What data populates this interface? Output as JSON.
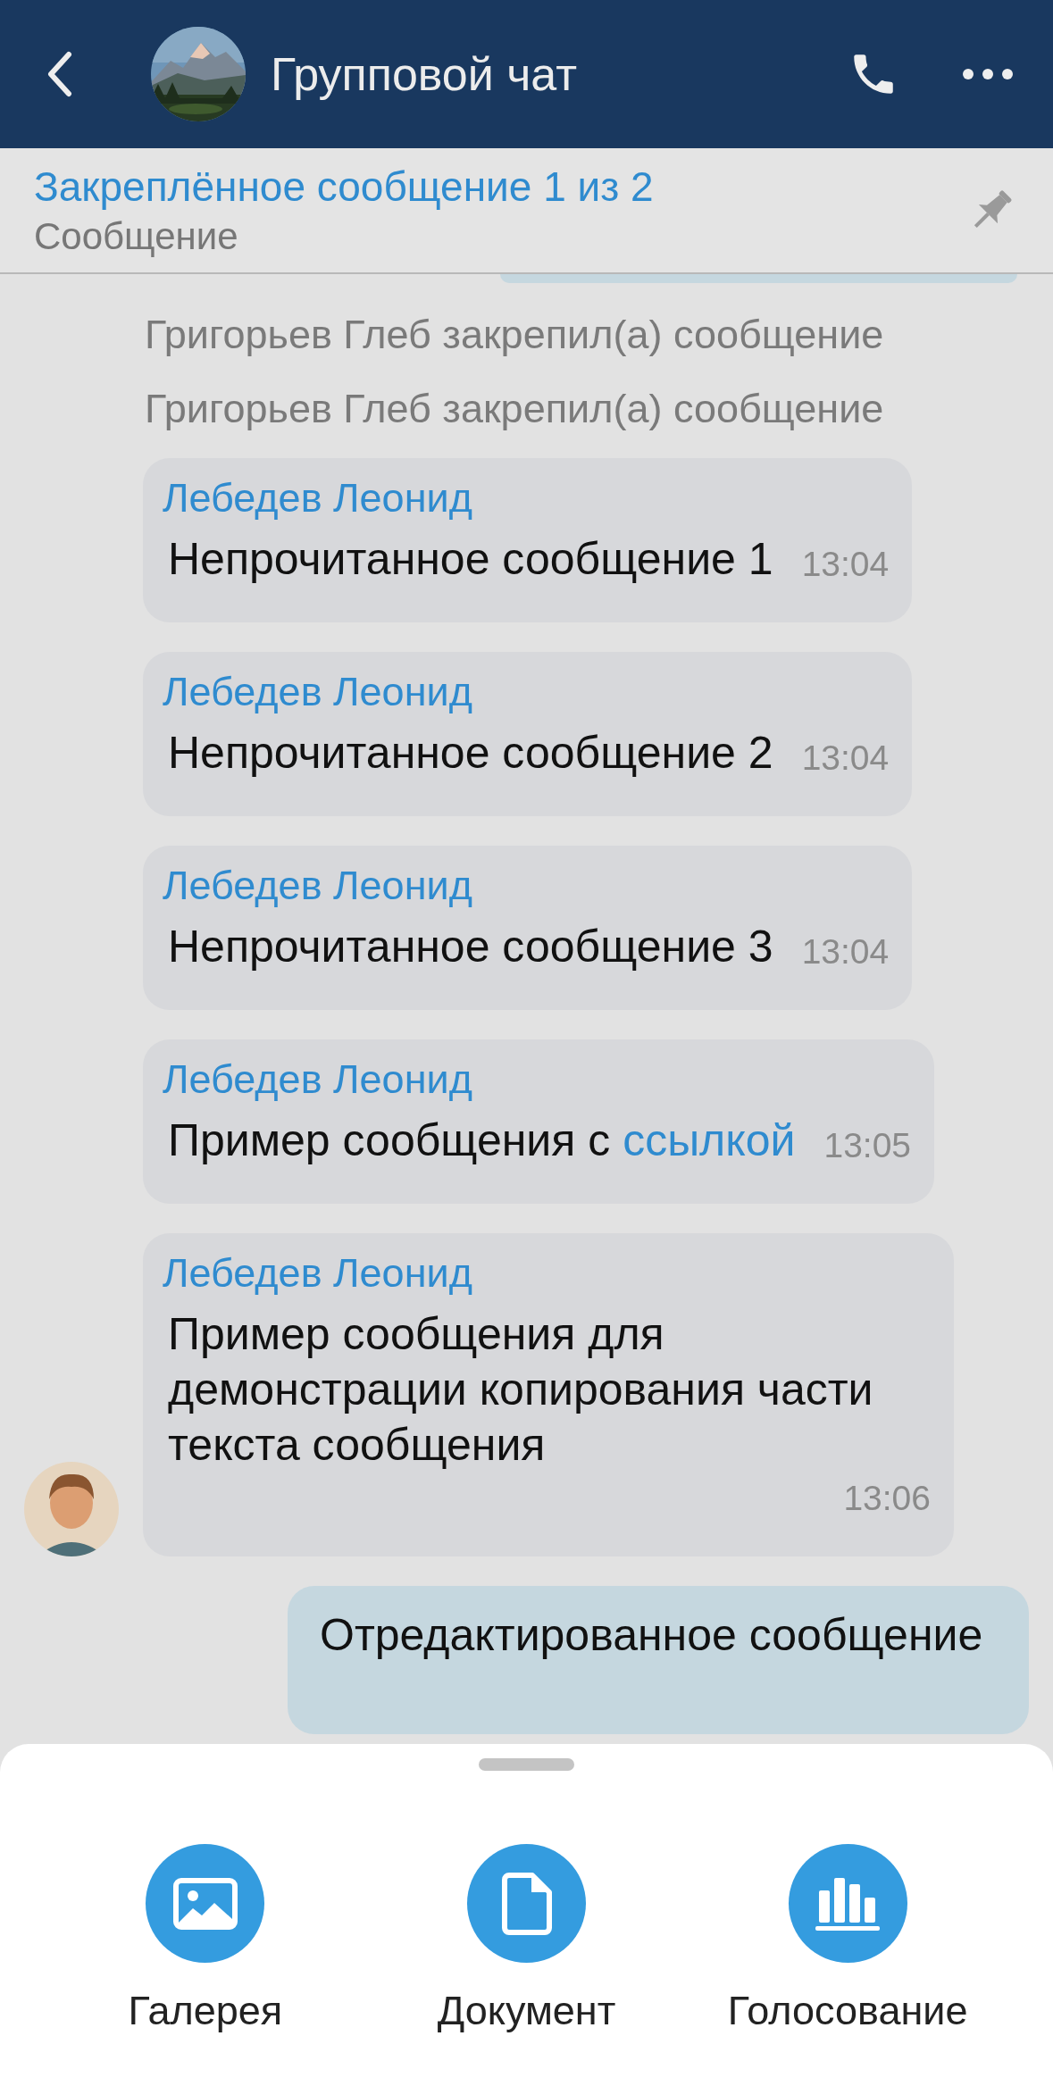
{
  "header": {
    "title": "Групповой чат"
  },
  "pinned": {
    "title": "Закреплённое сообщение 1 из 2",
    "text": "Сообщение"
  },
  "messages": [
    {
      "kind": "system",
      "text": "Григорьев Глеб закрепил(а) сообщение"
    },
    {
      "kind": "system",
      "text": "Григорьев Глеб закрепил(а) сообщение"
    },
    {
      "kind": "incoming",
      "sender": "Лебедев Леонид",
      "text": "Непрочитанное сообщение 1",
      "time": "13:04",
      "show_avatar": false
    },
    {
      "kind": "incoming",
      "sender": "Лебедев Леонид",
      "text": "Непрочитанное сообщение 2",
      "time": "13:04",
      "show_avatar": false
    },
    {
      "kind": "incoming",
      "sender": "Лебедев Леонид",
      "text": "Непрочитанное сообщение 3",
      "time": "13:04",
      "show_avatar": false
    },
    {
      "kind": "incoming",
      "sender": "Лебедев Леонид",
      "text": "Пример сообщения с",
      "link": "ссылкой",
      "time": "13:05",
      "show_avatar": false
    },
    {
      "kind": "incoming",
      "sender": "Лебедев Леонид",
      "text": "Пример сообщения для демонстрации копирования части текста сообщения",
      "time": "13:06",
      "show_avatar": true
    },
    {
      "kind": "outgoing",
      "text": "Отредактированное сообщение"
    }
  ],
  "sheet": {
    "actions": [
      {
        "kind": "gallery",
        "label": "Галерея"
      },
      {
        "kind": "document",
        "label": "Документ"
      },
      {
        "kind": "poll",
        "label": "Голосование"
      }
    ]
  }
}
